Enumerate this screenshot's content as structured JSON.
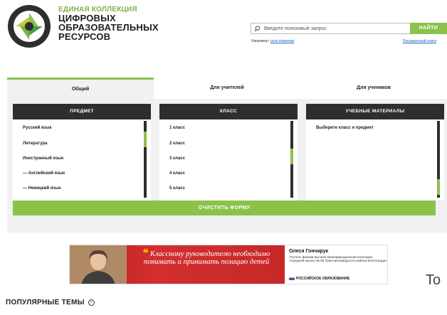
{
  "brand": {
    "line1": "ЕДИНАЯ КОЛЛЕКЦИЯ",
    "line2": "ЦИФРОВЫХ",
    "line3": "ОБРАЗОВАТЕЛЬНЫХ",
    "line4": "РЕСУРСОВ",
    "accent_color": "#8bc34a"
  },
  "search": {
    "placeholder": "Введите поисковый запрос",
    "button_label": "НАЙТИ",
    "example_prefix": "Например:",
    "example_link": "села Ахкинева",
    "advanced_link": "Расширенный поиск"
  },
  "tabs": [
    {
      "label": "Общий",
      "active": true
    },
    {
      "label": "Для учителей",
      "active": false
    },
    {
      "label": "Для учеников",
      "active": false
    }
  ],
  "columns": {
    "subject": {
      "header": "ПРЕДМЕТ",
      "items": [
        "Русский язык",
        "Литература",
        "Иностранный язык",
        "— Английский язык",
        "— Немецкий язык"
      ],
      "scroll_fraction": 0.18
    },
    "grade": {
      "header": "КЛАСС",
      "items": [
        "1 класс",
        "2 класс",
        "3 класс",
        "4 класс",
        "5 класс"
      ],
      "scroll_fraction": 0.45
    },
    "materials": {
      "header": "УЧЕБНЫЕ МАТЕРИАЛЫ",
      "items": [
        "Выберите класс и предмет"
      ],
      "scroll_fraction": 0.95
    }
  },
  "clear_button": "ОЧИСТИТЬ ФОРМУ",
  "banner": {
    "quote": "Классному руководителю необходимо понимать и принимать позицию детей",
    "quote_mark": "❝",
    "person_name": "Олеся Гончарук",
    "person_desc": "Учитель физики высшей квалификационной категории «Средней школы № 98 Тракторозаводского района Волгограда»",
    "partner": "РОССИЙСКОЕ ОБРАЗОВАНИЕ"
  },
  "side_text": "To",
  "popular": {
    "title": "ПОПУЛЯРНЫЕ ТЕМЫ",
    "icon": "›"
  }
}
